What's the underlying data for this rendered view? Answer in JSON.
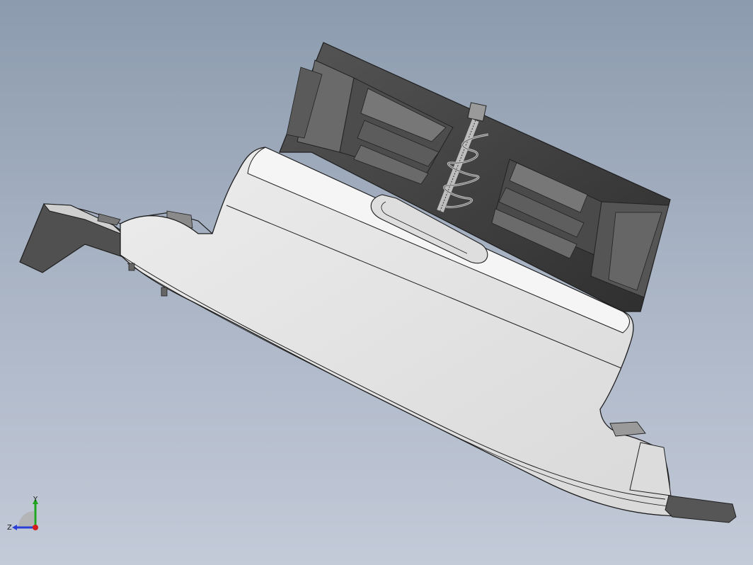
{
  "viewport": {
    "background_top": "#8c9bae",
    "background_bottom": "#c3cad8"
  },
  "model": {
    "body_color": "#e6e6e6",
    "cavity_color": "#3f3f3f",
    "edge_color": "#1e1e1e",
    "spring_color": "#b8b8b8"
  },
  "triad": {
    "y_label": "Y",
    "z_label": "Z",
    "y_color": "#1fa51f",
    "z_color": "#2b3fd6",
    "x_color": "#d41c1c"
  }
}
